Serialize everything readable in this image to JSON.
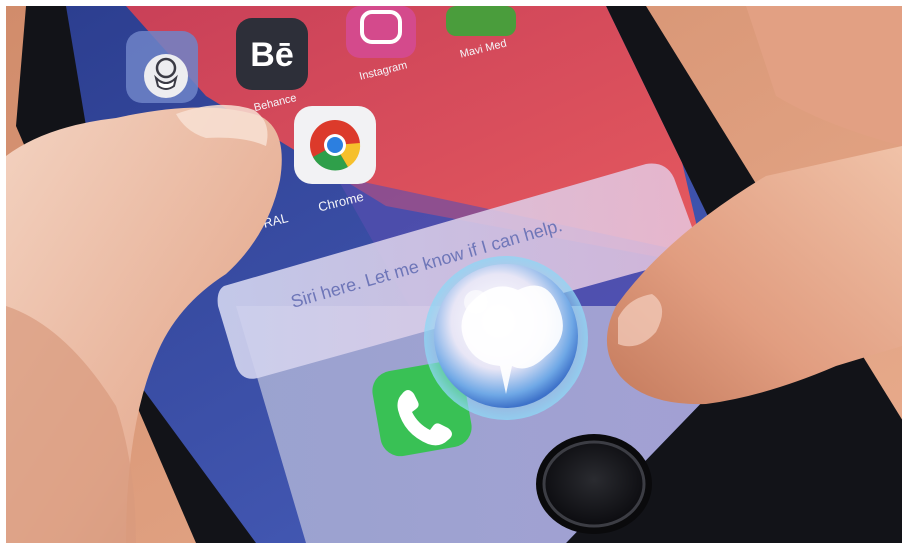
{
  "scene": {
    "description_colors": {
      "skin": "#e8a88c",
      "wallpaper_red": "#d8435a",
      "wallpaper_blue": "#3c4fa8",
      "phone_body": "#16171c",
      "siri_banner": "#c7cbe9",
      "phone_icon_green": "#39c155",
      "chrome_red": "#dc3a2b",
      "chrome_yellow": "#f6c02c",
      "chrome_green": "#2f9f4a",
      "chrome_blue": "#2c7fe0"
    }
  },
  "apps": {
    "behance_glyph": "Bē",
    "behance_label": "Behance",
    "instagram_label": "Instagram",
    "chrome_label": "Chrome",
    "partial_label": "ENTRAL",
    "top_label": "Mavi Med"
  },
  "siri": {
    "banner_text": "Siri here. Let me know if I can help."
  },
  "icons": {
    "person_icon": "face-mask-avatar-icon",
    "phone_icon": "phone-call-icon",
    "chrome_icon": "chrome-icon",
    "siri_icon": "siri-orb-icon",
    "home_button": "home-button"
  }
}
